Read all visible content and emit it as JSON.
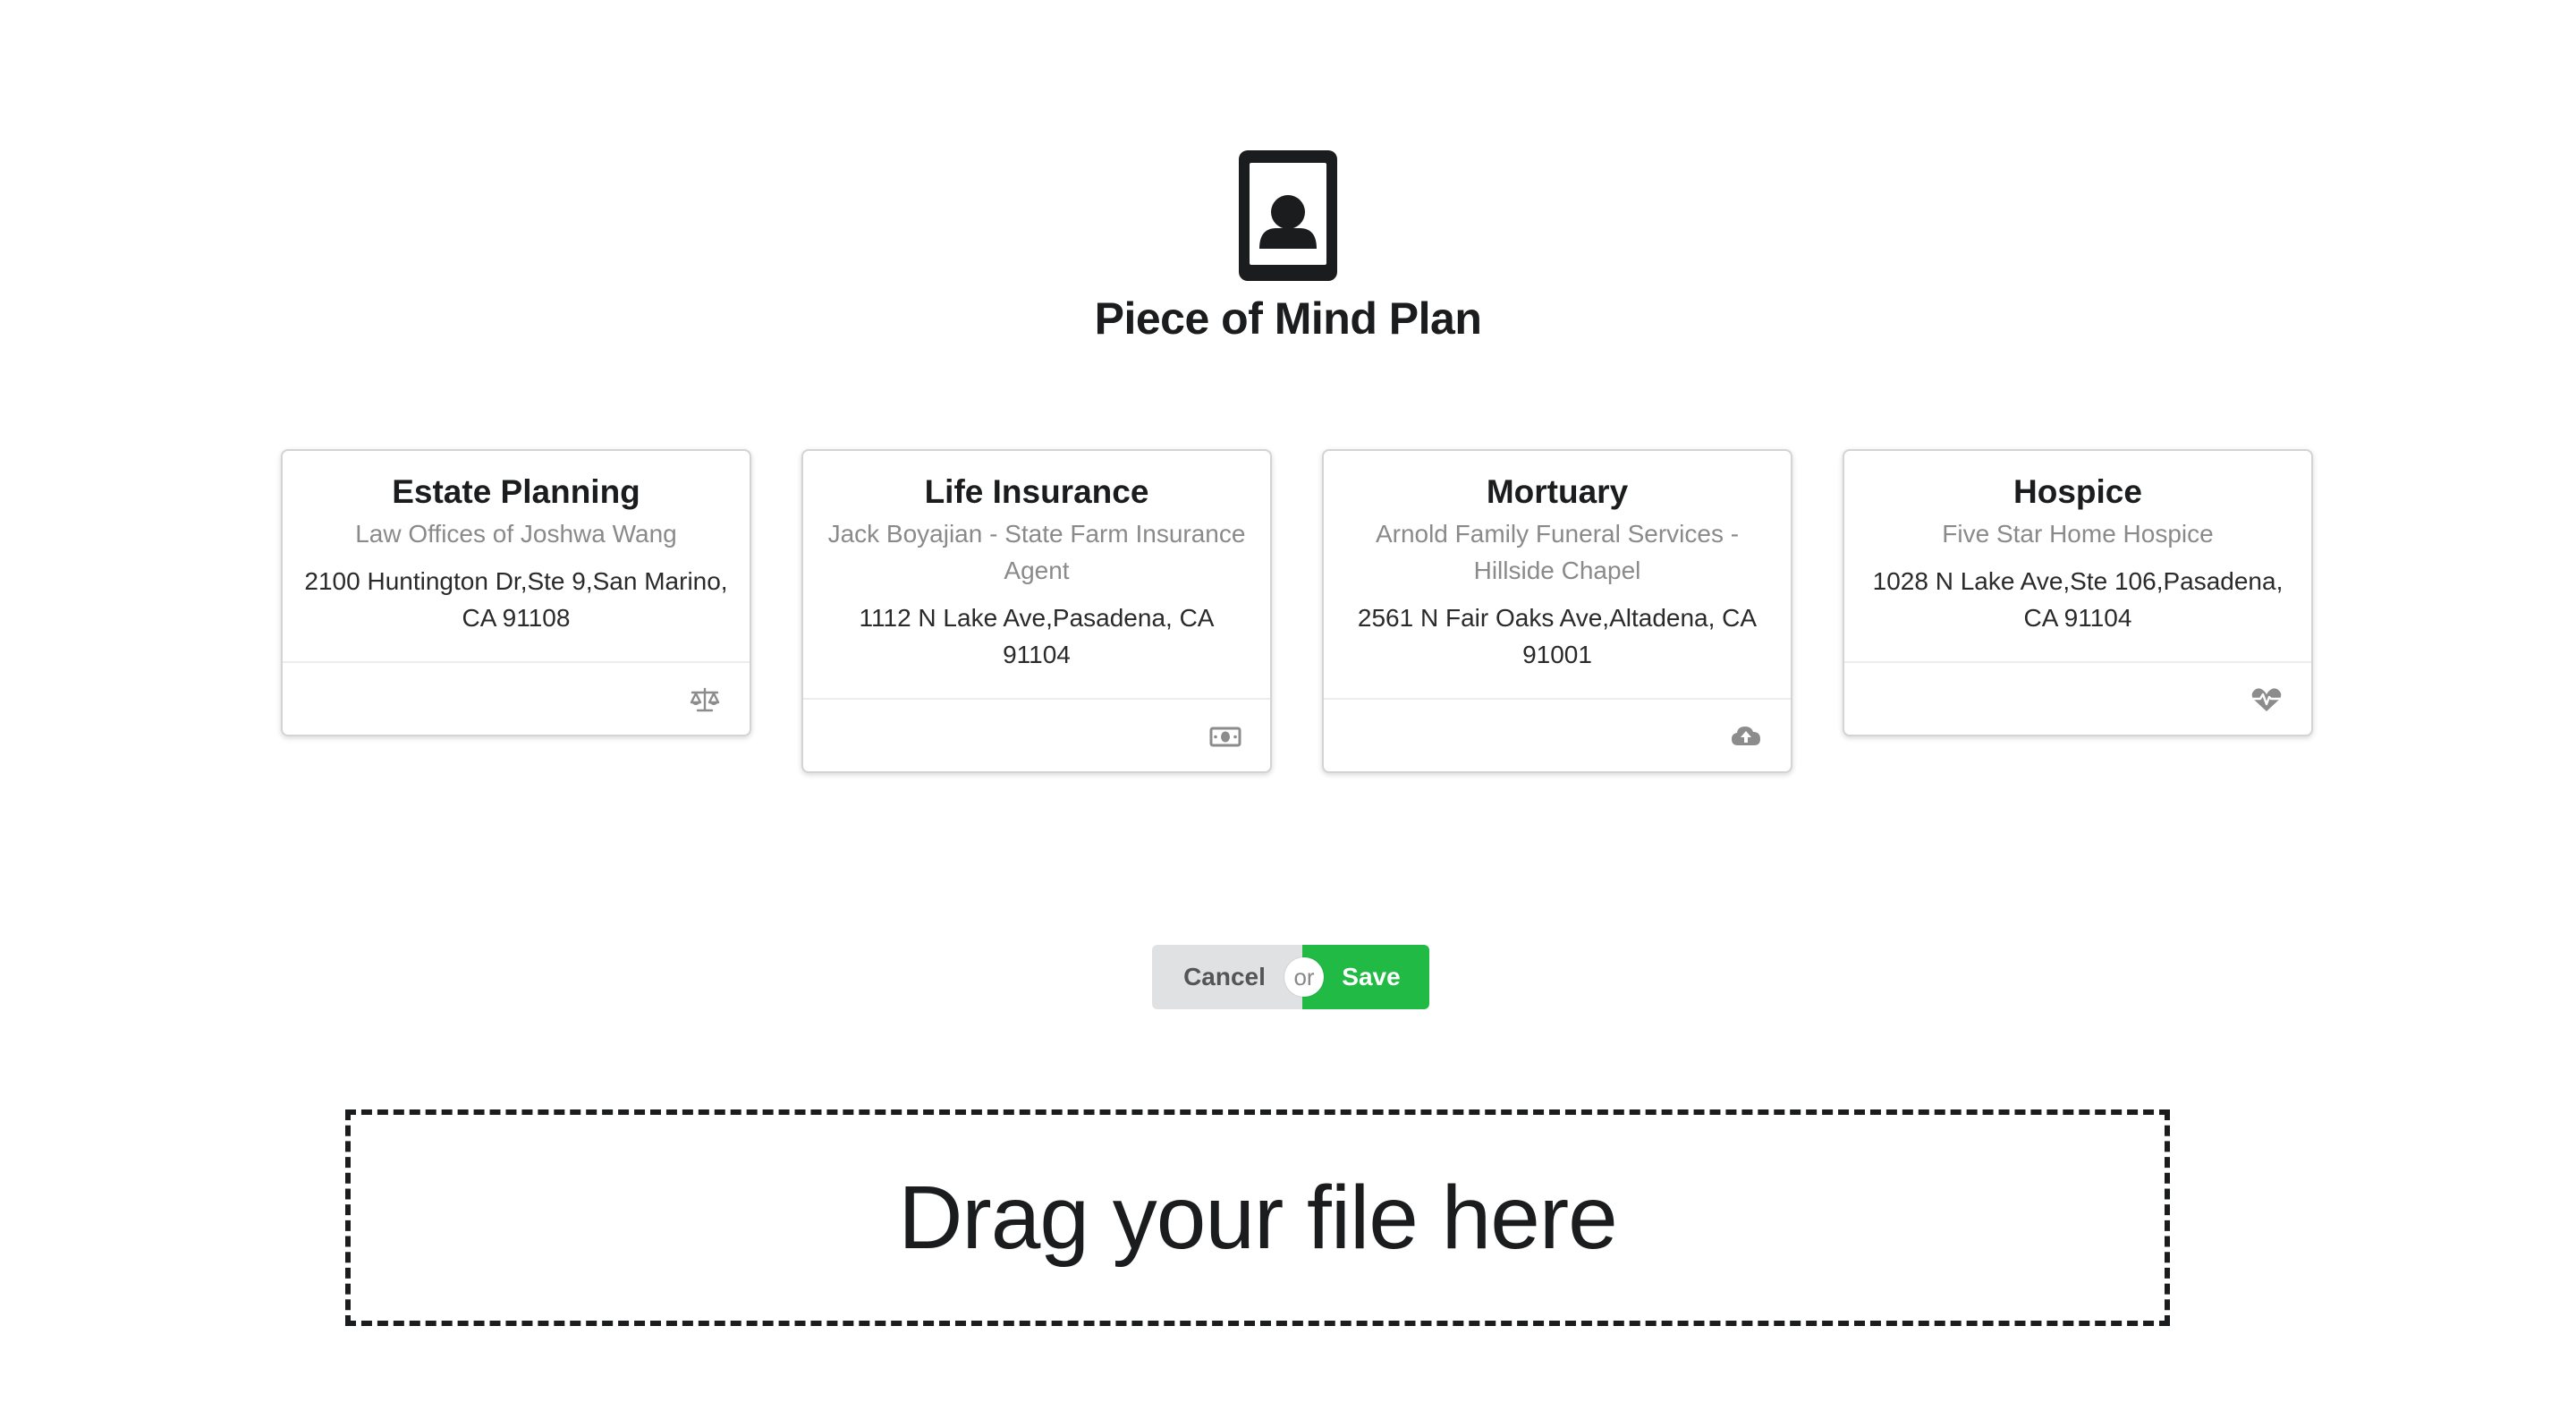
{
  "page": {
    "title": "Piece of Mind Plan",
    "icon": "contact-card-icon"
  },
  "cards": [
    {
      "header": "Estate Planning",
      "meta": "Law Offices of Joshwa Wang",
      "description": "2100 Huntington Dr,Ste 9,San Marino, CA 91108",
      "icon": "balance-scale-icon"
    },
    {
      "header": "Life Insurance",
      "meta": "Jack Boyajian - State Farm Insurance Agent",
      "description": "1112 N Lake Ave,Pasadena, CA 91104",
      "icon": "money-bill-icon"
    },
    {
      "header": "Mortuary",
      "meta": "Arnold Family Funeral Services - Hillside Chapel",
      "description": "2561 N Fair Oaks Ave,Altadena, CA 91001",
      "icon": "cloud-upload-icon"
    },
    {
      "header": "Hospice",
      "meta": "Five Star Home Hospice",
      "description": "1028 N Lake Ave,Ste 106,Pasadena, CA 91104",
      "icon": "heartbeat-icon"
    }
  ],
  "actions": {
    "cancel_label": "Cancel",
    "or_label": "or",
    "save_label": "Save"
  },
  "dropzone": {
    "label": "Drag your file here"
  },
  "colors": {
    "save": "#21ba45",
    "cancel": "#e0e1e2",
    "meta_text": "#8a8a8a",
    "icon_gray": "#8c8c8c"
  }
}
